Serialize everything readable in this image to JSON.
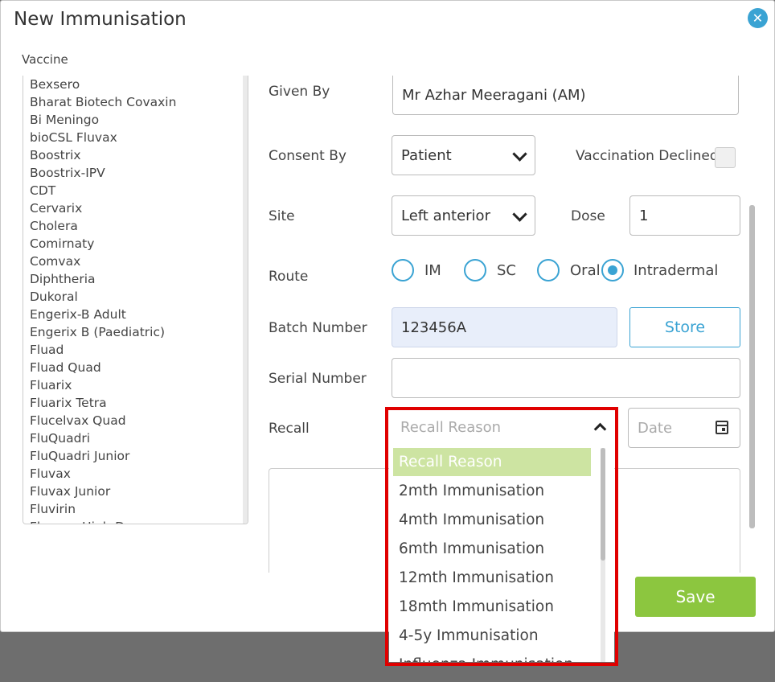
{
  "dialog": {
    "title": "New Immunisation"
  },
  "vaccine": {
    "label": "Vaccine",
    "items": [
      "Bexsero",
      "Bharat Biotech Covaxin",
      "Bi Meningo",
      "bioCSL Fluvax",
      "Boostrix",
      "Boostrix-IPV",
      "CDT",
      "Cervarix",
      "Cholera",
      "Comirnaty",
      "Comvax",
      "Diphtheria",
      "Dukoral",
      "Engerix-B Adult",
      "Engerix B (Paediatric)",
      "Fluad",
      "Fluad Quad",
      "Fluarix",
      "Fluarix Tetra",
      "Flucelvax Quad",
      "FluQuadri",
      "FluQuadri Junior",
      "Fluvax",
      "Fluvax Junior",
      "Fluvirin",
      "Fluzone High-Dose"
    ]
  },
  "form": {
    "given_by_label": "Given By",
    "given_by_value": "Mr Azhar Meeragani (AM)",
    "consent_label": "Consent By",
    "consent_value": "Patient",
    "declined_label": "Vaccination Declined",
    "site_label": "Site",
    "site_value": "Left anterior",
    "dose_label": "Dose",
    "dose_value": "1",
    "route_label": "Route",
    "route_options": [
      "IM",
      "SC",
      "Oral",
      "Intradermal"
    ],
    "route_selected": "Intradermal",
    "batch_label": "Batch Number",
    "batch_value": "123456A",
    "store_label": "Store",
    "serial_label": "Serial Number",
    "serial_value": "",
    "recall_label": "Recall",
    "recall_placeholder": "Recall Reason",
    "date_placeholder": "Date",
    "save_label": "Save"
  },
  "recall_dropdown": {
    "selected": "Recall Reason",
    "options": [
      "Recall Reason",
      "2mth Immunisation",
      "4mth Immunisation",
      "6mth Immunisation",
      "12mth Immunisation",
      "18mth Immunisation",
      "4-5y Immunisation",
      "Influenza Immunisation"
    ]
  },
  "colors": {
    "accent": "#3aa3d3",
    "save": "#8cc63f",
    "highlight": "#cde4a2",
    "annotation": "#e00000"
  }
}
